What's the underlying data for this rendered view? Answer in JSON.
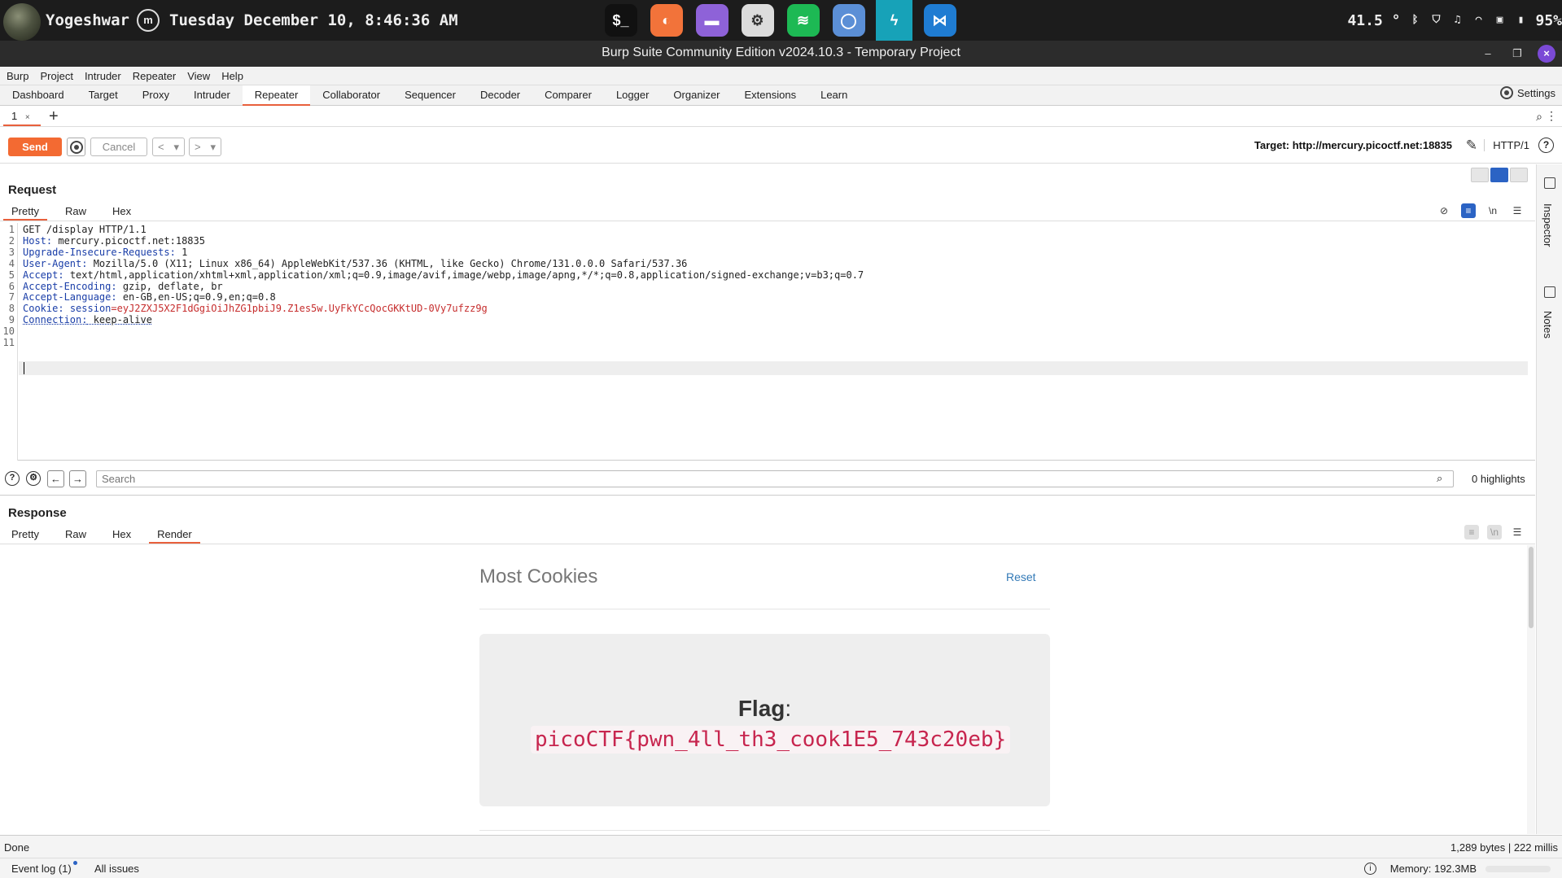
{
  "os": {
    "user": "Yogeshwar",
    "clock_icon_glyph": "m",
    "datetime": "Tuesday December 10, 8:46:36 AM",
    "dock": [
      {
        "name": "terminal",
        "glyph": "$_",
        "color": "#111111"
      },
      {
        "name": "firefox",
        "glyph": "◐",
        "color": "#f2733a"
      },
      {
        "name": "files",
        "glyph": "▬",
        "color": "#8e62d8"
      },
      {
        "name": "settings",
        "glyph": "⚙",
        "color": "#dcdcdc"
      },
      {
        "name": "spotify",
        "glyph": "≋",
        "color": "#1db954"
      },
      {
        "name": "chromium",
        "glyph": "◯",
        "color": "#5b8fd6"
      },
      {
        "name": "burp",
        "glyph": "ϟ",
        "color": "#17a2b8"
      },
      {
        "name": "vscode",
        "glyph": "⋈",
        "color": "#1f7cd2"
      }
    ],
    "temp": "41.5 °",
    "battery": "95%"
  },
  "window": {
    "title": "Burp Suite Community Edition v2024.10.3 - Temporary Project"
  },
  "menu": [
    "Burp",
    "Project",
    "Intruder",
    "Repeater",
    "View",
    "Help"
  ],
  "tool_tabs": [
    "Dashboard",
    "Target",
    "Proxy",
    "Intruder",
    "Repeater",
    "Collaborator",
    "Sequencer",
    "Decoder",
    "Comparer",
    "Logger",
    "Organizer",
    "Extensions",
    "Learn"
  ],
  "active_tool_tab": "Repeater",
  "settings_label": "Settings",
  "repeater": {
    "tab_label": "1",
    "tab_close": "×",
    "add_tab": "+",
    "send_label": "Send",
    "cancel_label": "Cancel",
    "prev": "<",
    "next": ">",
    "dropdown": "▾",
    "target_label": "Target: http://mercury.picoctf.net:18835",
    "http_version": "HTTP/1"
  },
  "rail": {
    "inspector": "Inspector",
    "notes": "Notes"
  },
  "request": {
    "title": "Request",
    "tabs": [
      "Pretty",
      "Raw",
      "Hex"
    ],
    "newline_toggle": "\\n",
    "lines": [
      {
        "n": "1",
        "key": "",
        "sep": "",
        "value": "GET /display HTTP/1.1"
      },
      {
        "n": "2",
        "key": "Host",
        "sep": ":",
        "value": " mercury.picoctf.net:18835"
      },
      {
        "n": "3",
        "key": "Upgrade-Insecure-Requests",
        "sep": ":",
        "value": " 1"
      },
      {
        "n": "4",
        "key": "User-Agent",
        "sep": ":",
        "value": " Mozilla/5.0 (X11; Linux x86_64) AppleWebKit/537.36 (KHTML, like Gecko) Chrome/131.0.0.0 Safari/537.36"
      },
      {
        "n": "5",
        "key": "Accept",
        "sep": ":",
        "value": " text/html,application/xhtml+xml,application/xml;q=0.9,image/avif,image/webp,image/apng,*/*;q=0.8,application/signed-exchange;v=b3;q=0.7"
      },
      {
        "n": "6",
        "key": "Accept-Encoding",
        "sep": ":",
        "value": " gzip, deflate, br"
      },
      {
        "n": "7",
        "key": "Accept-Language",
        "sep": ":",
        "value": " en-GB,en-US;q=0.9,en;q=0.8"
      },
      {
        "n": "8",
        "key": "Cookie",
        "sep": ":",
        "value": " ",
        "cookie_name": "session",
        "cookie_value": "=eyJ2ZXJ5X2F1dGgiOiJhZG1pbiJ9.Z1es5w.UyFkYCcQocGKKtUD-0Vy7ufzz9g"
      },
      {
        "n": "9",
        "key": "Connection",
        "sep": ":",
        "value": " keep-alive"
      },
      {
        "n": "10",
        "key": "",
        "sep": "",
        "value": ""
      },
      {
        "n": "11",
        "key": "",
        "sep": "",
        "value": ""
      }
    ]
  },
  "search": {
    "placeholder": "Search",
    "highlights": "0 highlights"
  },
  "response": {
    "title": "Response",
    "tabs": [
      "Pretty",
      "Raw",
      "Hex",
      "Render"
    ],
    "active_tab": "Render",
    "newline_toggle": "\\n",
    "render": {
      "site_title": "Most Cookies",
      "reset_link": "Reset",
      "flag_label": "Flag",
      "flag_colon": ":",
      "flag_value": "picoCTF{pwn_4ll_th3_cook1E5_743c20eb}"
    }
  },
  "status": {
    "text": "Done",
    "size": "1,289 bytes | 222 millis"
  },
  "bottom": {
    "event_log": "Event log (1)",
    "all_issues": "All issues",
    "memory": "Memory: 192.3MB"
  },
  "colors": {
    "accent": "#e8603c",
    "send": "#f36a32",
    "key": "#1a3ea8",
    "cookie": "#c62d2d",
    "flag": "#c7254e"
  }
}
